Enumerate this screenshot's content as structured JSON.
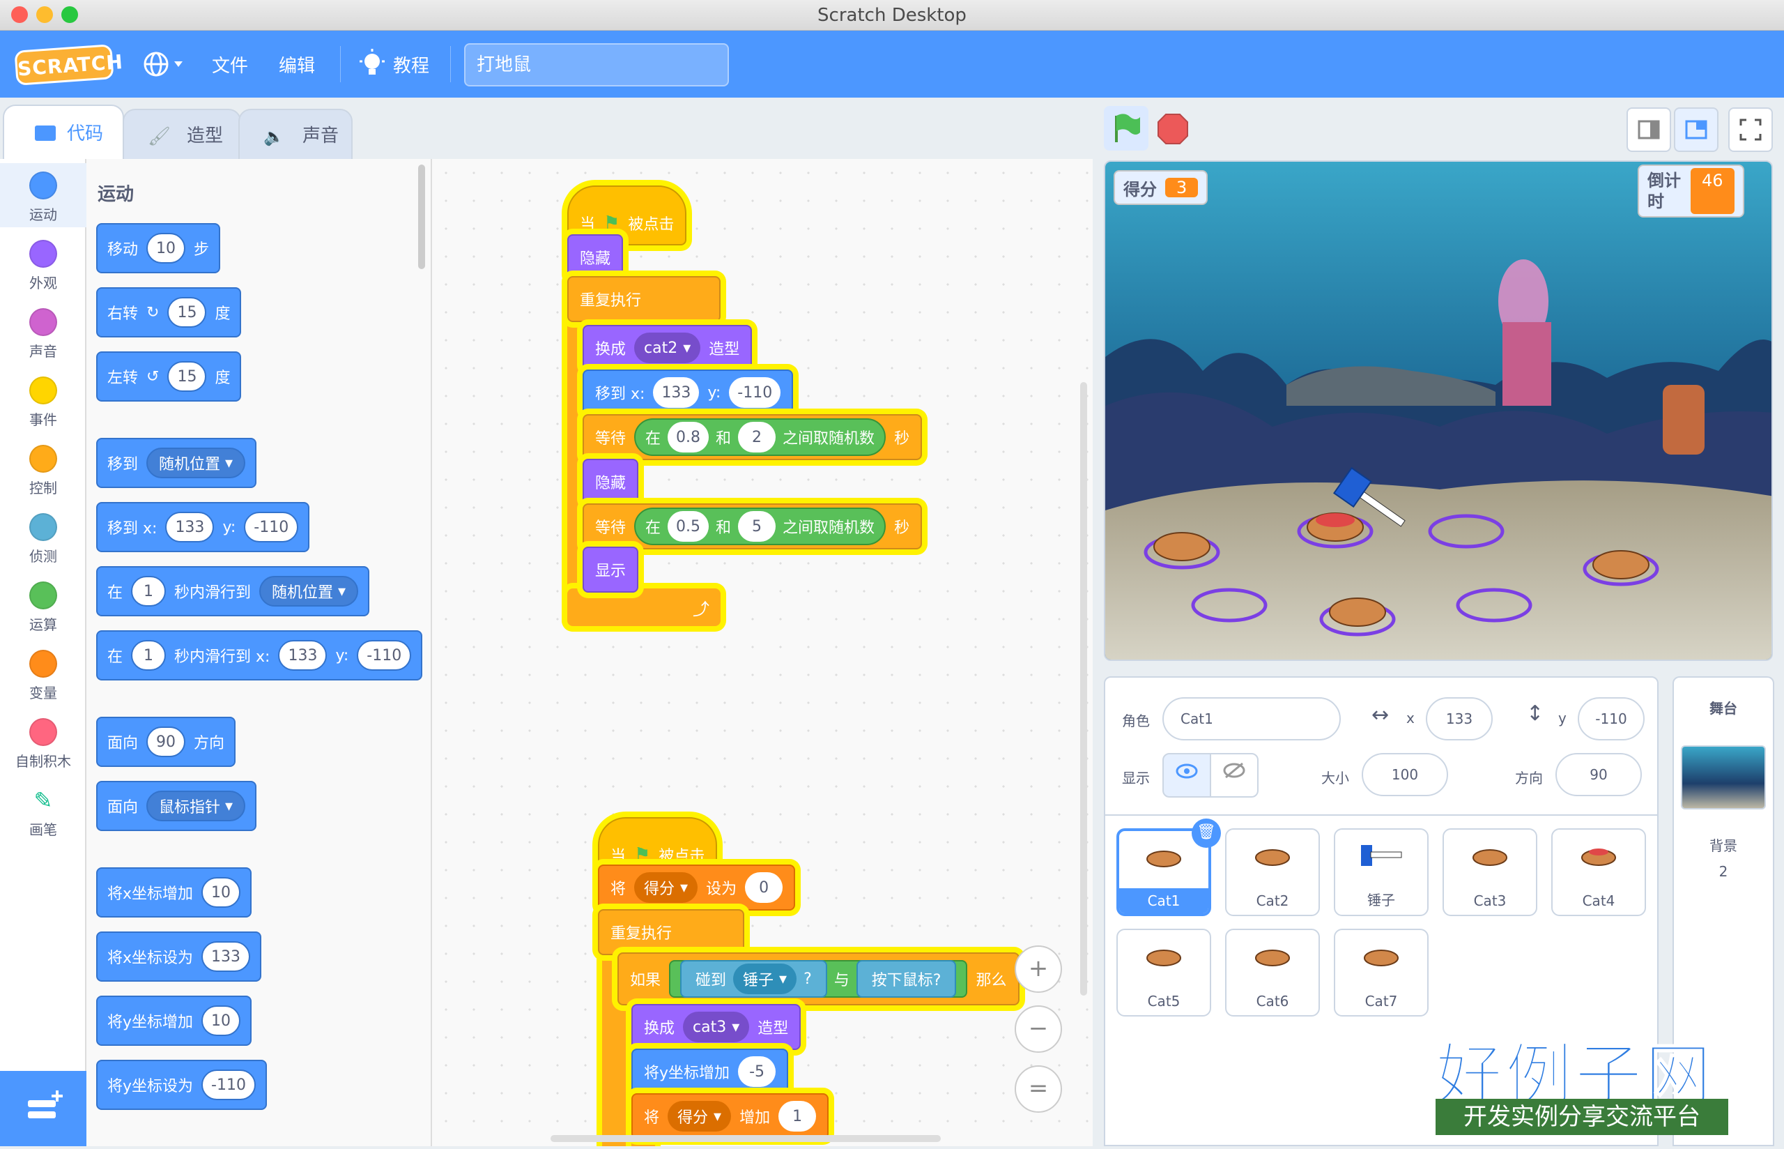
{
  "window": {
    "title": "Scratch Desktop"
  },
  "menubar": {
    "logo": "SCRATCH",
    "file": "文件",
    "edit": "编辑",
    "tutorials": "教程",
    "project_title": "打地鼠"
  },
  "tabs": {
    "code": "代码",
    "costumes": "造型",
    "sounds": "声音"
  },
  "categories": [
    {
      "label": "运动",
      "color": "#4c97ff"
    },
    {
      "label": "外观",
      "color": "#9966ff"
    },
    {
      "label": "声音",
      "color": "#cf63cf"
    },
    {
      "label": "事件",
      "color": "#ffd500"
    },
    {
      "label": "控制",
      "color": "#ffab19"
    },
    {
      "label": "侦测",
      "color": "#5cb1d6"
    },
    {
      "label": "运算",
      "color": "#59c059"
    },
    {
      "label": "变量",
      "color": "#ff8c1a"
    },
    {
      "label": "自制积木",
      "color": "#ff6680"
    },
    {
      "label": "画笔",
      "color": "#0fbd8c"
    }
  ],
  "palette": {
    "title": "运动",
    "move": {
      "a": "移动",
      "v": "10",
      "b": "步"
    },
    "turn_right": {
      "a": "右转",
      "v": "15",
      "b": "度"
    },
    "turn_left": {
      "a": "左转",
      "v": "15",
      "b": "度"
    },
    "goto": {
      "a": "移到",
      "dd": "随机位置"
    },
    "goto_xy": {
      "a": "移到 x:",
      "x": "133",
      "y_label": "y:",
      "y": "-110"
    },
    "glide": {
      "a": "在",
      "v": "1",
      "b": "秒内滑行到",
      "dd": "随机位置"
    },
    "glide_xy": {
      "a": "在",
      "v": "1",
      "b": "秒内滑行到 x:",
      "x": "133",
      "y_label": "y:",
      "y": "-110"
    },
    "point_dir": {
      "a": "面向",
      "v": "90",
      "b": "方向"
    },
    "point_towards": {
      "a": "面向",
      "dd": "鼠标指针"
    },
    "change_x": {
      "a": "将x坐标增加",
      "v": "10"
    },
    "set_x": {
      "a": "将x坐标设为",
      "v": "133"
    },
    "change_y": {
      "a": "将y坐标增加",
      "v": "10"
    },
    "set_y": {
      "a": "将y坐标设为",
      "v": "-110"
    }
  },
  "script1": {
    "hat": {
      "a": "当",
      "b": "被点击"
    },
    "hide": "隐藏",
    "forever": "重复执行",
    "switch": {
      "a": "换成",
      "dd": "cat2",
      "b": "造型"
    },
    "goto": {
      "a": "移到 x:",
      "x": "133",
      "y_label": "y:",
      "y": "-110"
    },
    "wait1": {
      "a": "等待",
      "in": "在",
      "v1": "0.8",
      "and": "和",
      "v2": "2",
      "rand": "之间取随机数",
      "sec": "秒"
    },
    "hide2": "隐藏",
    "wait2": {
      "a": "等待",
      "in": "在",
      "v1": "0.5",
      "and": "和",
      "v2": "5",
      "rand": "之间取随机数",
      "sec": "秒"
    },
    "show": "显示"
  },
  "script2": {
    "hat": {
      "a": "当",
      "b": "被点击"
    },
    "set": {
      "a": "将",
      "dd": "得分",
      "b": "设为",
      "v": "0"
    },
    "forever": "重复执行",
    "if": {
      "a": "如果",
      "touch": "碰到",
      "dd": "锤子",
      "q": "?",
      "and": "与",
      "mouse": "按下鼠标?",
      "then": "那么"
    },
    "switch": {
      "a": "换成",
      "dd": "cat3",
      "b": "造型"
    },
    "change_y": {
      "a": "将y坐标增加",
      "v": "-5"
    },
    "change_var": {
      "a": "将",
      "dd": "得分",
      "b": "增加",
      "v": "1"
    }
  },
  "zoom": {
    "in": "+",
    "out": "−",
    "reset": "="
  },
  "stage": {
    "score_label": "得分",
    "score_value": "3",
    "timer_label": "倒计时",
    "timer_value": "46"
  },
  "sprite_info": {
    "sprite_label": "角色",
    "sprite_name": "Cat1",
    "x_label": "x",
    "x_value": "133",
    "y_label": "y",
    "y_value": "-110",
    "show_label": "显示",
    "size_label": "大小",
    "size_value": "100",
    "direction_label": "方向",
    "direction_value": "90"
  },
  "sprites": [
    "Cat1",
    "Cat2",
    "锤子",
    "Cat3",
    "Cat4",
    "Cat5",
    "Cat6",
    "Cat7"
  ],
  "stage_panel": {
    "title": "舞台",
    "backdrop_label": "背景",
    "backdrop_count": "2"
  },
  "watermark": {
    "title": "好例子网",
    "subtitle": "开发实例分享交流平台"
  }
}
